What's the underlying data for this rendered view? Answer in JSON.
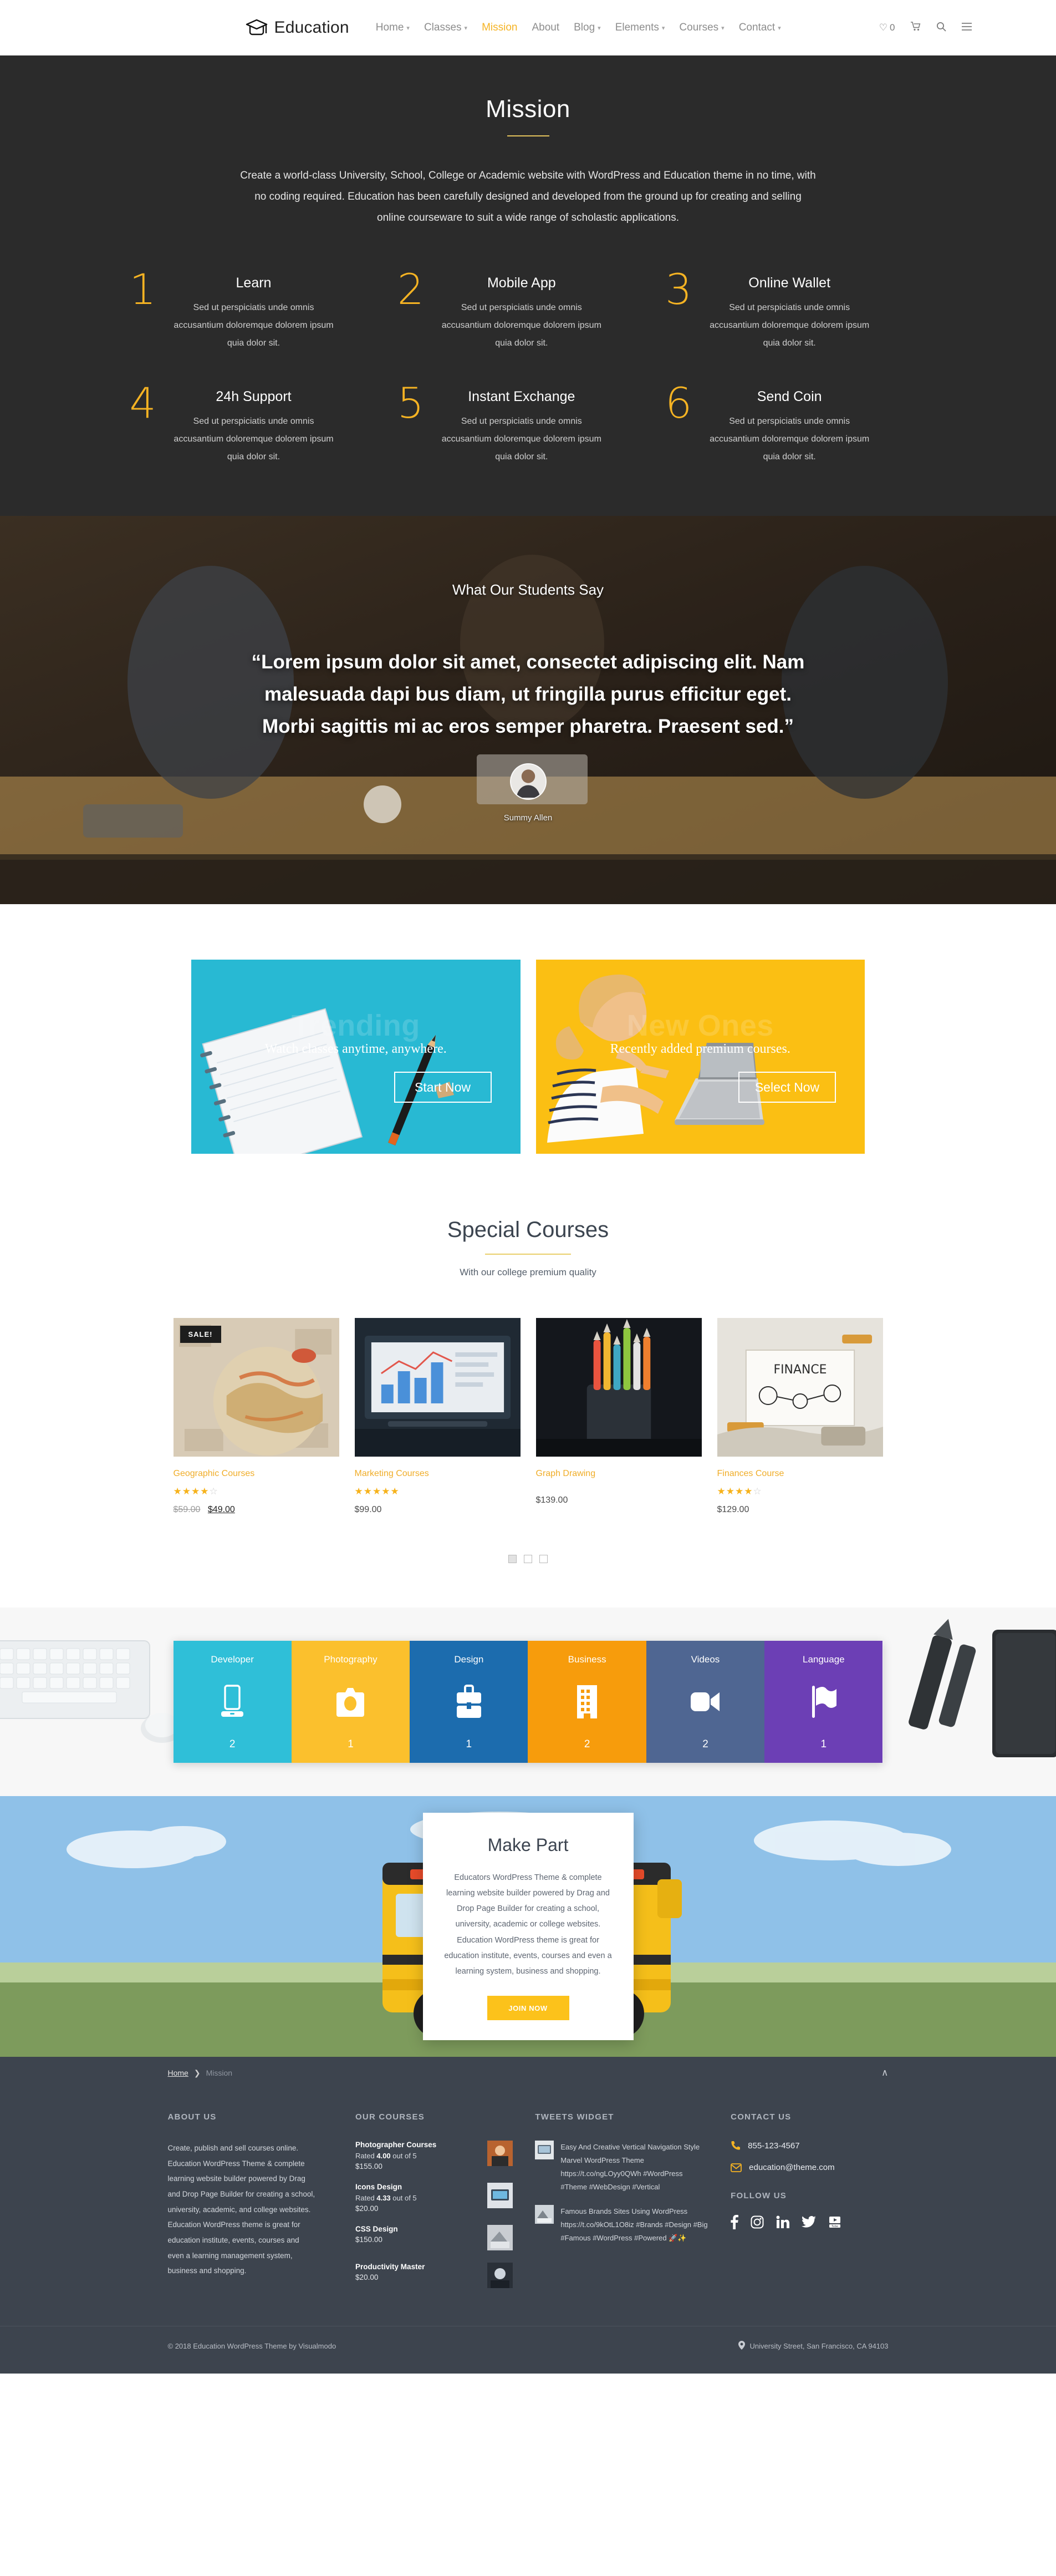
{
  "header": {
    "brand": "Education",
    "nav": [
      {
        "label": "Home",
        "caret": true,
        "active": false
      },
      {
        "label": "Classes",
        "caret": true,
        "active": false
      },
      {
        "label": "Mission",
        "caret": false,
        "active": true
      },
      {
        "label": "About",
        "caret": false,
        "active": false
      },
      {
        "label": "Blog",
        "caret": true,
        "active": false
      },
      {
        "label": "Elements",
        "caret": true,
        "active": false
      },
      {
        "label": "Courses",
        "caret": true,
        "active": false
      },
      {
        "label": "Contact",
        "caret": true,
        "active": false
      }
    ],
    "wishlist_count": "0",
    "cart_label": "cart-icon",
    "search_label": "search-icon",
    "menu_label": "hamburger-icon"
  },
  "hero": {
    "title": "Mission",
    "description": "Create a world-class University, School, College or Academic website with WordPress and Education theme in no time, with no coding required. Education has been carefully designed and developed from the ground up for creating and selling online courseware to suit a wide range of scholastic applications.",
    "features": [
      {
        "num": "1",
        "title": "Learn",
        "text": "Sed ut perspiciatis unde omnis accusantium doloremque dolorem ipsum quia dolor sit."
      },
      {
        "num": "2",
        "title": "Mobile App",
        "text": "Sed ut perspiciatis unde omnis accusantium doloremque dolorem ipsum quia dolor sit."
      },
      {
        "num": "3",
        "title": "Online Wallet",
        "text": "Sed ut perspiciatis unde omnis accusantium doloremque dolorem ipsum quia dolor sit."
      },
      {
        "num": "4",
        "title": "24h Support",
        "text": "Sed ut perspiciatis unde omnis accusantium doloremque dolorem ipsum quia dolor sit."
      },
      {
        "num": "5",
        "title": "Instant Exchange",
        "text": "Sed ut perspiciatis unde omnis accusantium doloremque dolorem ipsum quia dolor sit."
      },
      {
        "num": "6",
        "title": "Send Coin",
        "text": "Sed ut perspiciatis unde omnis accusantium doloremque dolorem ipsum quia dolor sit."
      }
    ]
  },
  "testimonial": {
    "kicker": "What Our Students Say",
    "quote": "“Lorem ipsum dolor sit amet, consectet adipiscing elit. Nam malesuada dapi bus diam, ut fringilla purus efficitur eget. Morbi sagittis mi ac eros semper pharetra. Praesent sed.”",
    "author": "Summy Allen"
  },
  "promos": [
    {
      "ghost": "Trending",
      "sub": "Watch classes anytime, anywhere.",
      "button": "Start Now",
      "color": "#28b9d3"
    },
    {
      "ghost": "New Ones",
      "sub": "Recently added premium courses.",
      "button": "Select Now",
      "color": "#fbbf13"
    }
  ],
  "special_courses": {
    "title": "Special Courses",
    "subtitle": "With our college premium quality",
    "items": [
      {
        "name": "Geographic Courses",
        "badge": "SALE!",
        "stars": 4.5,
        "old_price": "$59.00",
        "price": "$49.00"
      },
      {
        "name": "Marketing Courses",
        "badge": "",
        "stars": 5,
        "old_price": "",
        "price": "$99.00"
      },
      {
        "name": "Graph Drawing",
        "badge": "",
        "stars": 0,
        "old_price": "",
        "price": "$139.00"
      },
      {
        "name": "Finances Course",
        "badge": "",
        "stars": 4,
        "old_price": "",
        "price": "$129.00"
      }
    ],
    "dots": [
      "1",
      "2",
      "3"
    ],
    "active_dot": 0
  },
  "categories": [
    {
      "label": "Developer",
      "count": "2",
      "color": "#2fbfd8",
      "icon": "mobile-icon"
    },
    {
      "label": "Photography",
      "count": "1",
      "color": "#fbc02d",
      "icon": "camera-icon"
    },
    {
      "label": "Design",
      "count": "1",
      "color": "#1c6cae",
      "icon": "briefcase-icon"
    },
    {
      "label": "Business",
      "count": "2",
      "color": "#f79c0c",
      "icon": "building-icon"
    },
    {
      "label": "Videos",
      "count": "2",
      "color": "#4f6692",
      "icon": "video-camera-icon"
    },
    {
      "label": "Language",
      "count": "1",
      "color": "#6c3fb5",
      "icon": "flag-icon"
    }
  ],
  "make_part": {
    "title": "Make Part",
    "text": "Educators WordPress Theme & complete learning website builder powered by Drag and Drop Page Builder for creating a school, university, academic or college websites. Education WordPress theme is great for education institute, events, courses and even a learning system, business and shopping.",
    "button": "JOIN NOW"
  },
  "breadcrumb": {
    "home": "Home",
    "separator": "❯",
    "current": "Mission",
    "to_top": "∧"
  },
  "footer": {
    "about": {
      "title": "ABOUT US",
      "text": "Create, publish and sell courses online. Education WordPress Theme & complete learning website builder powered by Drag and Drop Page Builder for creating a school, university, academic, and college websites. Education WordPress theme is great for education institute, events, courses and even a learning management system, business and shopping."
    },
    "courses": {
      "title": "OUR COURSES",
      "items": [
        {
          "name": "Photographer Courses",
          "rated_prefix": "Rated ",
          "rated": "4.00",
          "rated_suffix": " out of 5",
          "price": "$155.00"
        },
        {
          "name": "Icons Design",
          "rated_prefix": "Rated ",
          "rated": "4.33",
          "rated_suffix": " out of 5",
          "price": "$20.00"
        },
        {
          "name": "CSS Design",
          "rated_prefix": "",
          "rated": "",
          "rated_suffix": "",
          "price": "$150.00"
        },
        {
          "name": "Productivity Master",
          "rated_prefix": "",
          "rated": "",
          "rated_suffix": "",
          "price": "$20.00"
        }
      ]
    },
    "tweets": {
      "title": "TWEETS WIDGET",
      "items": [
        {
          "text": "Easy And Creative Vertical Navigation Style Marvel WordPress Theme https://t.co/ngLOyy0QWh #WordPress #Theme #WebDesign #Vertical"
        },
        {
          "text": "Famous Brands Sites Using WordPress https://t.co/9kOtL1O8iz #Brands #Design #Big #Famous #WordPress #Powered 🚀✨"
        }
      ]
    },
    "contact": {
      "title": "CONTACT US",
      "phone": "855-123-4567",
      "email": "education@theme.com",
      "follow_title": "FOLLOW US",
      "socials": [
        "facebook-icon",
        "instagram-icon",
        "linkedin-icon",
        "twitter-icon",
        "youtube-icon"
      ]
    },
    "bottom": {
      "copyright": "© 2018 Education WordPress Theme by Visualmodo",
      "address": "University Street, San Francisco, CA 94103"
    }
  },
  "colors": {
    "accent": "#f5b323",
    "dark": "#2b2b2b",
    "footer": "#3d444e"
  }
}
